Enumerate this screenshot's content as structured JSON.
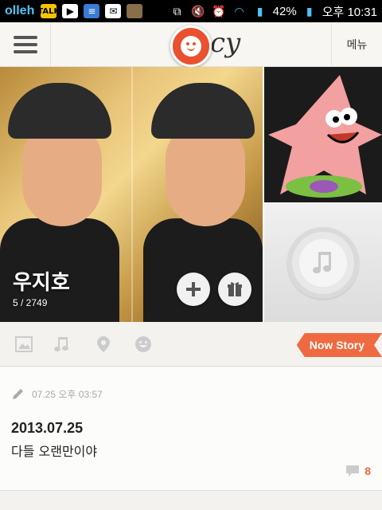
{
  "status_bar": {
    "carrier": "olleh",
    "battery": "42%",
    "time": "오후 10:31"
  },
  "header": {
    "logo_script": "cy",
    "menu_label": "메뉴"
  },
  "profile": {
    "name": "우지호",
    "count": "5 / 2749"
  },
  "toolbar": {
    "now_story_label": "Now Story"
  },
  "post": {
    "meta": "07.25 오후 03:57",
    "date": "2013.07.25",
    "body": "다들 오랜만이야",
    "comment_count": "8"
  },
  "colors": {
    "accent": "#ef6a40",
    "logo": "#e9512f"
  }
}
